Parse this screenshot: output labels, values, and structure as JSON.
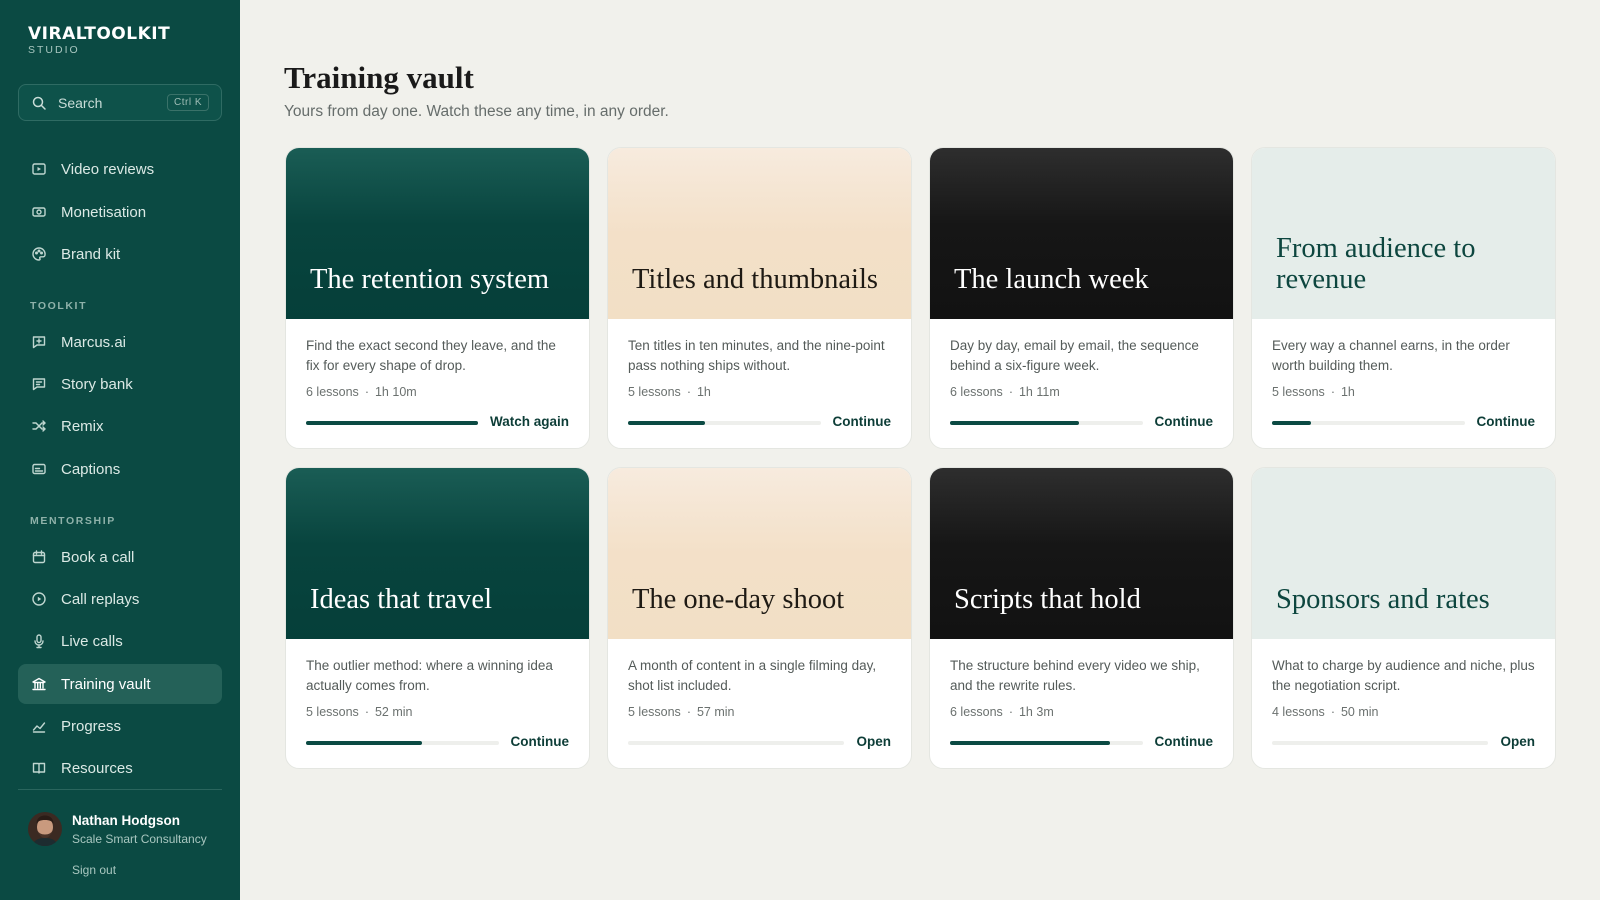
{
  "brand": {
    "name": "VIRALTOOLKIT",
    "sub": "STUDIO"
  },
  "search": {
    "placeholder": "Search",
    "shortcut": "Ctrl K"
  },
  "nav": {
    "main": [
      {
        "label": "Video reviews",
        "icon": "video-icon"
      },
      {
        "label": "Monetisation",
        "icon": "money-icon"
      },
      {
        "label": "Brand kit",
        "icon": "palette-icon"
      }
    ],
    "toolkit_label": "TOOLKIT",
    "toolkit": [
      {
        "label": "Marcus.ai",
        "icon": "chat-sparkle-icon"
      },
      {
        "label": "Story bank",
        "icon": "message-icon"
      },
      {
        "label": "Remix",
        "icon": "shuffle-icon"
      },
      {
        "label": "Captions",
        "icon": "captions-icon"
      }
    ],
    "mentorship_label": "MENTORSHIP",
    "mentorship": [
      {
        "label": "Book a call",
        "icon": "calendar-icon"
      },
      {
        "label": "Call replays",
        "icon": "play-circle-icon"
      },
      {
        "label": "Live calls",
        "icon": "microphone-icon"
      },
      {
        "label": "Training vault",
        "icon": "vault-icon",
        "active": true
      },
      {
        "label": "Progress",
        "icon": "chart-line-icon"
      },
      {
        "label": "Resources",
        "icon": "book-icon"
      }
    ]
  },
  "user": {
    "name": "Nathan Hodgson",
    "org": "Scale Smart Consultancy",
    "signout": "Sign out"
  },
  "page": {
    "title": "Training vault",
    "subtitle": "Yours from day one. Watch these any time, in any order."
  },
  "courses": [
    {
      "title": "The retention system",
      "theme": "green",
      "desc": "Find the exact second they leave, and the fix for every shape of drop.",
      "lessons": "6 lessons",
      "duration": "1h 10m",
      "progress": 1.0,
      "action": "Watch again"
    },
    {
      "title": "Titles and thumbnails",
      "theme": "sand",
      "desc": "Ten titles in ten minutes, and the nine-point pass nothing ships without.",
      "lessons": "5 lessons",
      "duration": "1h",
      "progress": 0.4,
      "action": "Continue"
    },
    {
      "title": "The launch week",
      "theme": "black",
      "desc": "Day by day, email by email, the sequence behind a six-figure week.",
      "lessons": "6 lessons",
      "duration": "1h 11m",
      "progress": 0.67,
      "action": "Continue"
    },
    {
      "title": "From audience to revenue",
      "theme": "mint",
      "desc": "Every way a channel earns, in the order worth building them.",
      "lessons": "5 lessons",
      "duration": "1h",
      "progress": 0.2,
      "action": "Continue"
    },
    {
      "title": "Ideas that travel",
      "theme": "green",
      "desc": "The outlier method: where a winning idea actually comes from.",
      "lessons": "5 lessons",
      "duration": "52 min",
      "progress": 0.6,
      "action": "Continue"
    },
    {
      "title": "The one-day shoot",
      "theme": "sand",
      "desc": "A month of content in a single filming day, shot list included.",
      "lessons": "5 lessons",
      "duration": "57 min",
      "progress": 0,
      "action": "Open"
    },
    {
      "title": "Scripts that hold",
      "theme": "black",
      "desc": "The structure behind every video we ship, and the rewrite rules.",
      "lessons": "6 lessons",
      "duration": "1h 3m",
      "progress": 0.83,
      "action": "Continue"
    },
    {
      "title": "Sponsors and rates",
      "theme": "mint",
      "desc": "What to charge by audience and niche, plus the negotiation script.",
      "lessons": "4 lessons",
      "duration": "50 min",
      "progress": 0,
      "action": "Open"
    }
  ]
}
